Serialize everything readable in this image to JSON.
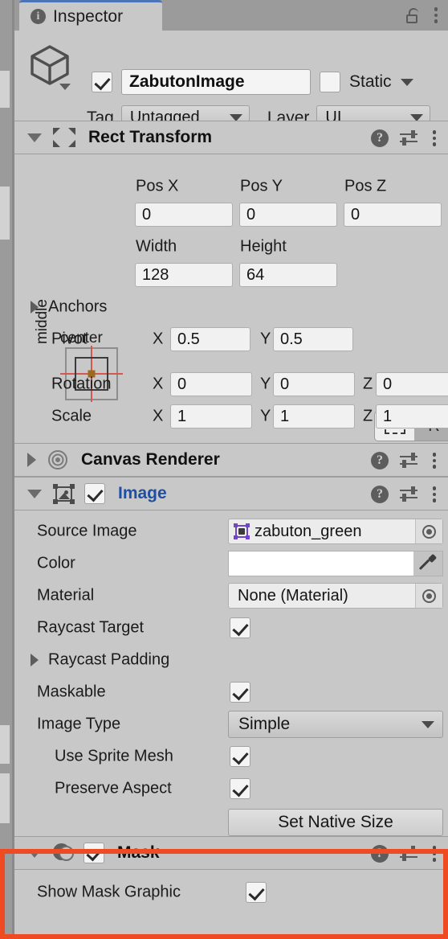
{
  "window": {
    "tab_label": "Inspector",
    "info_icon": "info-icon",
    "lock_icon": "lock-icon",
    "menu_icon": "kebab-menu-icon",
    "accent_color": "#4a74b5",
    "panel_bg": "#c8c8c8",
    "highlight_color": "#f04a23"
  },
  "game_object": {
    "enabled": true,
    "name": "ZabutonImage",
    "static_checked": false,
    "static_label": "Static",
    "tag_label": "Tag",
    "tag_value": "Untagged",
    "layer_label": "Layer",
    "layer_value": "UI",
    "icon": "cube-icon"
  },
  "components": [
    {
      "id": "rect-transform",
      "title": "Rect Transform",
      "expanded": true,
      "icon": "rect-transform-icon",
      "has_checkbox": false,
      "help_icon": "help-icon",
      "preset_icon": "preset-settings-icon",
      "menu_icon": "kebab-menu-icon",
      "anchor": {
        "horizontal_label": "center",
        "vertical_label": "middle"
      },
      "fields": {
        "pos_x_label": "Pos X",
        "pos_x": "0",
        "pos_y_label": "Pos Y",
        "pos_y": "0",
        "pos_z_label": "Pos Z",
        "pos_z": "0",
        "width_label": "Width",
        "width": "128",
        "height_label": "Height",
        "height": "64"
      },
      "toggles": {
        "blueprint_icon": "blueprint-mode-icon",
        "raw_label": "R",
        "raw_active": true
      },
      "anchors_label": "Anchors",
      "anchors_expanded": false,
      "pivot_label": "Pivot",
      "pivot": {
        "x_axis": "X",
        "x": "0.5",
        "y_axis": "Y",
        "y": "0.5"
      },
      "rotation_label": "Rotation",
      "rotation": {
        "x_axis": "X",
        "x": "0",
        "y_axis": "Y",
        "y": "0",
        "z_axis": "Z",
        "z": "0"
      },
      "scale_label": "Scale",
      "scale": {
        "x_axis": "X",
        "x": "1",
        "y_axis": "Y",
        "y": "1",
        "z_axis": "Z",
        "z": "1"
      }
    },
    {
      "id": "canvas-renderer",
      "title": "Canvas Renderer",
      "expanded": false,
      "icon": "canvas-renderer-icon",
      "has_checkbox": false
    },
    {
      "id": "image",
      "title": "Image",
      "expanded": true,
      "icon": "image-component-icon",
      "has_checkbox": true,
      "enabled": true,
      "title_is_link": true,
      "properties": {
        "source_image_label": "Source Image",
        "source_image_value": "zabuton_green",
        "source_image_icon": "sprite-icon",
        "color_label": "Color",
        "color_value": "#ffffff",
        "eyedropper_icon": "eyedropper-icon",
        "material_label": "Material",
        "material_value": "None (Material)",
        "raycast_target_label": "Raycast Target",
        "raycast_target_checked": true,
        "raycast_padding_label": "Raycast Padding",
        "raycast_padding_expanded": false,
        "maskable_label": "Maskable",
        "maskable_checked": true,
        "image_type_label": "Image Type",
        "image_type_value": "Simple",
        "use_sprite_mesh_label": "Use Sprite Mesh",
        "use_sprite_mesh_checked": true,
        "preserve_aspect_label": "Preserve Aspect",
        "preserve_aspect_checked": true,
        "set_native_size_label": "Set Native Size"
      }
    },
    {
      "id": "mask",
      "title": "Mask",
      "expanded": true,
      "icon": "mask-component-icon",
      "has_checkbox": true,
      "enabled": true,
      "highlighted": true,
      "properties": {
        "show_mask_graphic_label": "Show Mask Graphic",
        "show_mask_graphic_checked": true
      }
    }
  ]
}
